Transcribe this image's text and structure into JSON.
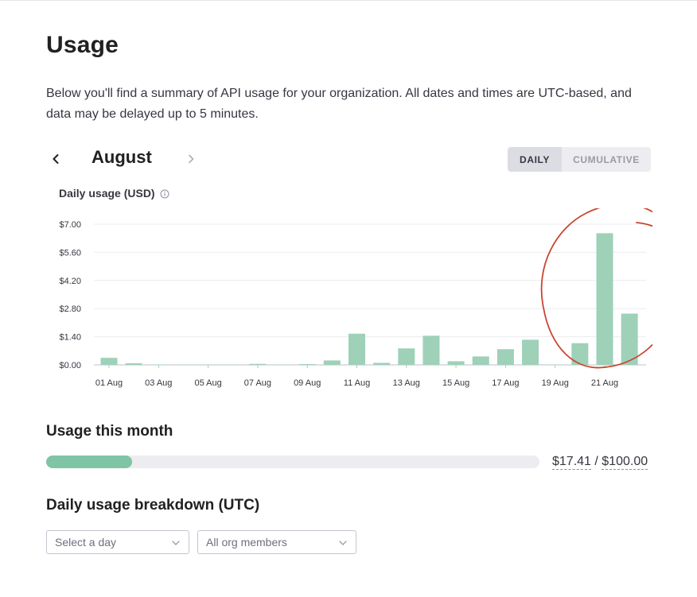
{
  "header": {
    "title": "Usage",
    "intro": "Below you'll find a summary of API usage for your organization. All dates and times are UTC-based, and data may be delayed up to 5 minutes."
  },
  "month_nav": {
    "month": "August",
    "prev_icon": "chevron-left-icon",
    "next_icon": "chevron-right-icon"
  },
  "view_toggle": {
    "daily_label": "DAILY",
    "cumulative_label": "CUMULATIVE",
    "selected": "DAILY"
  },
  "chart_section": {
    "title": "Daily usage (USD)",
    "info_icon": "info-icon"
  },
  "chart_data": {
    "type": "bar",
    "title": "Daily usage (USD)",
    "xlabel": "",
    "ylabel": "",
    "ylim": [
      0,
      7.0
    ],
    "yticks": [
      "$7.00",
      "$5.60",
      "$4.20",
      "$2.80",
      "$1.40",
      "$0.00"
    ],
    "ytick_values": [
      7.0,
      5.6,
      4.2,
      2.8,
      1.4,
      0.0
    ],
    "xtick_labels": [
      "01 Aug",
      "03 Aug",
      "05 Aug",
      "07 Aug",
      "09 Aug",
      "11 Aug",
      "13 Aug",
      "15 Aug",
      "17 Aug",
      "19 Aug",
      "21 Aug"
    ],
    "categories": [
      "01 Aug",
      "02 Aug",
      "03 Aug",
      "04 Aug",
      "05 Aug",
      "06 Aug",
      "07 Aug",
      "08 Aug",
      "09 Aug",
      "10 Aug",
      "11 Aug",
      "12 Aug",
      "13 Aug",
      "14 Aug",
      "15 Aug",
      "16 Aug",
      "17 Aug",
      "18 Aug",
      "19 Aug",
      "20 Aug",
      "21 Aug",
      "22 Aug"
    ],
    "values": [
      0.35,
      0.08,
      0.02,
      0.01,
      0.01,
      0.01,
      0.05,
      0.01,
      0.04,
      0.22,
      1.55,
      0.1,
      0.82,
      1.45,
      0.18,
      0.42,
      0.78,
      1.25,
      0.02,
      1.08,
      6.55,
      2.55
    ],
    "bar_color": "#9ed1b8",
    "grid": true
  },
  "annotation": {
    "color": "#c9452f",
    "shape": "hand-drawn circle around 20–22 Aug bars"
  },
  "usage_month": {
    "title": "Usage this month",
    "used": "$17.41",
    "separator": " / ",
    "limit": "$100.00",
    "progress_fraction": 0.1741,
    "bar_color": "#7fc4a4"
  },
  "breakdown": {
    "title": "Daily usage breakdown (UTC)",
    "day_placeholder": "Select a day",
    "members_value": "All org members"
  }
}
